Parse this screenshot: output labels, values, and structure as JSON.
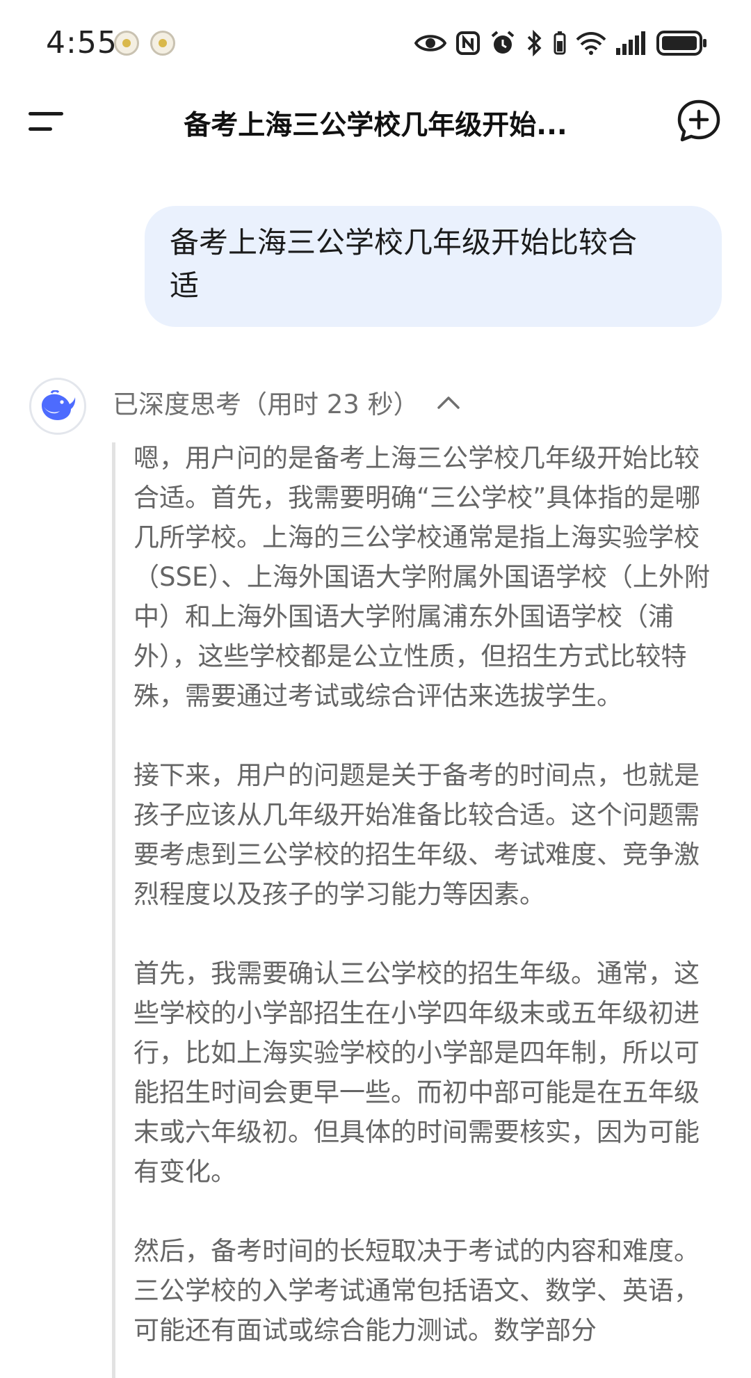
{
  "status_bar": {
    "time": "4:55",
    "icons": [
      "notification-icon",
      "notification-icon",
      "eye-icon",
      "nfc-icon",
      "alarm-icon",
      "bluetooth-icon",
      "battery-small-icon",
      "wifi-icon",
      "signal-icon",
      "battery-icon"
    ]
  },
  "header": {
    "menu_icon": "menu-icon",
    "title": "备考上海三公学校几年级开始...",
    "new_chat_icon": "new-chat-icon"
  },
  "user_message": {
    "line1": "备考上海三公学校几年级开始比较合",
    "line2": "适"
  },
  "assistant": {
    "avatar_icon": "deepseek-whale-icon",
    "thinking_label": "已深度思考（用时 23 秒）",
    "toggle_icon": "chevron-up-icon",
    "paragraphs": [
      "嗯，用户问的是备考上海三公学校几年级开始比较合适。首先，我需要明确“三公学校”具体指的是哪几所学校。上海的三公学校通常是指上海实验学校（SSE）、上海外国语大学附属外国语学校（上外附中）和上海外国语大学附属浦东外国语学校（浦外），这些学校都是公立性质，但招生方式比较特殊，需要通过考试或综合评估来选拔学生。",
      "接下来，用户的问题是关于备考的时间点，也就是孩子应该从几年级开始准备比较合适。这个问题需要考虑到三公学校的招生年级、考试难度、竞争激烈程度以及孩子的学习能力等因素。",
      "首先，我需要确认三公学校的招生年级。通常，这些学校的小学部招生在小学四年级末或五年级初进行，比如上海实验学校的小学部是四年制，所以可能招生时间会更早一些。而初中部可能是在五年级末或六年级初。但具体的时间需要核实，因为可能有变化。",
      "然后，备考时间的长短取决于考试的内容和难度。三公学校的入学考试通常包括语文、数学、英语，可能还有面试或综合能力测试。数学部分"
    ]
  },
  "colors": {
    "user_bubble_bg": "#eaf1fd",
    "accent_blue": "#4d6bfe",
    "thinking_text": "#656565"
  }
}
